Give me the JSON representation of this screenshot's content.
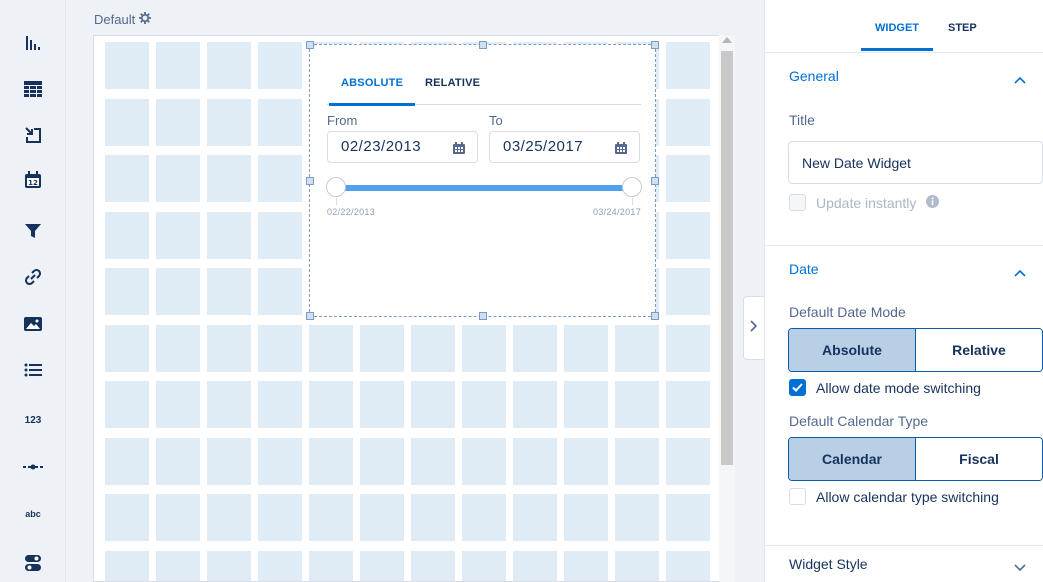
{
  "canvas": {
    "page_label": "Default"
  },
  "widget": {
    "tabs": [
      "ABSOLUTE",
      "RELATIVE"
    ],
    "active_tab": "ABSOLUTE",
    "from_label": "From",
    "to_label": "To",
    "from_value": "02/23/2013",
    "to_value": "03/25/2017",
    "range_min_label": "02/22/2013",
    "range_max_label": "03/24/2017"
  },
  "panel": {
    "tabs": [
      "WIDGET",
      "STEP"
    ],
    "active_tab": "WIDGET",
    "general": {
      "title": "General",
      "title_label": "Title",
      "title_value": "New Date Widget",
      "update_instantly_label": "Update instantly",
      "update_instantly_checked": false
    },
    "date": {
      "title": "Date",
      "default_mode_label": "Default Date Mode",
      "mode_options": [
        "Absolute",
        "Relative"
      ],
      "mode_selected": "Absolute",
      "allow_mode_switching_label": "Allow date mode switching",
      "allow_mode_switching_checked": true,
      "default_calendar_label": "Default Calendar Type",
      "calendar_options": [
        "Calendar",
        "Fiscal"
      ],
      "calendar_selected": "Calendar",
      "allow_calendar_switching_label": "Allow calendar type switching",
      "allow_calendar_switching_checked": false
    },
    "widget_style": {
      "title": "Widget Style"
    }
  },
  "toolbar": {
    "items": [
      "chart-icon",
      "table-icon",
      "compare-table-icon",
      "date-icon",
      "filter-icon",
      "link-icon",
      "image-icon",
      "list-icon",
      "number-icon",
      "range-icon",
      "text-icon",
      "toggle-icon"
    ],
    "number_text": "123",
    "text_text": "abc"
  },
  "colors": {
    "accent": "#0070d2",
    "cell": "#dfecf6",
    "selected_segment": "#b9cfe6"
  }
}
